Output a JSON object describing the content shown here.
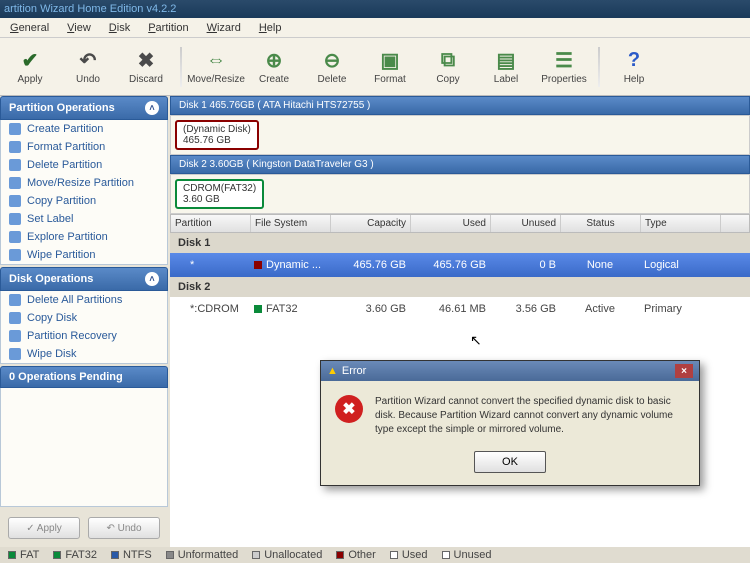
{
  "title": "artition Wizard Home Edition v4.2.2",
  "menu": [
    "General",
    "View",
    "Disk",
    "Partition",
    "Wizard",
    "Help"
  ],
  "toolbar": [
    {
      "label": "Apply",
      "icon": "✔",
      "color": "#2a6a2a"
    },
    {
      "label": "Undo",
      "icon": "↶",
      "color": "#4a4a4a"
    },
    {
      "label": "Discard",
      "icon": "✖",
      "color": "#4a4a4a"
    },
    {
      "sep": true
    },
    {
      "label": "Move/Resize",
      "icon": "⇔",
      "color": "#4a8a4a"
    },
    {
      "label": "Create",
      "icon": "⊕",
      "color": "#4a8a4a"
    },
    {
      "label": "Delete",
      "icon": "⊖",
      "color": "#4a8a4a"
    },
    {
      "label": "Format",
      "icon": "▣",
      "color": "#4a8a4a"
    },
    {
      "label": "Copy",
      "icon": "⧉",
      "color": "#4a8a4a"
    },
    {
      "label": "Label",
      "icon": "▤",
      "color": "#4a8a4a"
    },
    {
      "label": "Properties",
      "icon": "☰",
      "color": "#4a8a4a"
    },
    {
      "sep": true
    },
    {
      "label": "Help",
      "icon": "?",
      "color": "#2a5ac8"
    }
  ],
  "sidebar": {
    "partition_ops": {
      "title": "Partition Operations",
      "items": [
        "Create Partition",
        "Format Partition",
        "Delete Partition",
        "Move/Resize Partition",
        "Copy Partition",
        "Set Label",
        "Explore Partition",
        "Wipe Partition"
      ]
    },
    "disk_ops": {
      "title": "Disk Operations",
      "items": [
        "Delete All Partitions",
        "Copy Disk",
        "Partition Recovery",
        "Wipe Disk"
      ]
    },
    "pending": "0 Operations Pending",
    "apply_btn": "✓ Apply",
    "undo_btn": "↶ Undo"
  },
  "disks": [
    {
      "header": "Disk 1 465.76GB   ( ATA Hitachi HTS72755 )",
      "map_label": "(Dynamic Disk)",
      "map_size": "465.76 GB",
      "border": "#8a0000",
      "name": "Disk 1",
      "rows": [
        {
          "part": "*",
          "fs": "Dynamic ...",
          "fscolor": "#8a0000",
          "cap": "465.76 GB",
          "used": "465.76 GB",
          "unused": "0 B",
          "status": "None",
          "type": "Logical",
          "selected": true
        }
      ]
    },
    {
      "header": "Disk 2 3.60GB   ( Kingston DataTraveler G3 )",
      "map_label": "CDROM(FAT32)",
      "map_size": "3.60 GB",
      "border": "#0a8a3a",
      "name": "Disk 2",
      "rows": [
        {
          "part": "*:CDROM",
          "fs": "FAT32",
          "fscolor": "#0a8a3a",
          "cap": "3.60 GB",
          "used": "46.61 MB",
          "unused": "3.56 GB",
          "status": "Active",
          "type": "Primary",
          "selected": false
        }
      ]
    }
  ],
  "columns": [
    "Partition",
    "File System",
    "Capacity",
    "Used",
    "Unused",
    "Status",
    "Type"
  ],
  "legend": [
    {
      "label": "FAT",
      "color": "#0a8a3a"
    },
    {
      "label": "FAT32",
      "color": "#0a8a3a"
    },
    {
      "label": "NTFS",
      "color": "#2a5aa8"
    },
    {
      "label": "Unformatted",
      "color": "#888"
    },
    {
      "label": "Unallocated",
      "color": "#ccc"
    },
    {
      "label": "Other",
      "color": "#8a0000"
    },
    {
      "label": "Used",
      "color": "#fff",
      "border": true
    },
    {
      "label": "Unused",
      "color": "#fff",
      "border": true
    }
  ],
  "error": {
    "title": "Error",
    "message": "Partition Wizard cannot convert the specified dynamic disk to basic disk. Because Partition Wizard cannot convert any dynamic volume type except the simple or mirrored volume.",
    "ok": "OK"
  }
}
